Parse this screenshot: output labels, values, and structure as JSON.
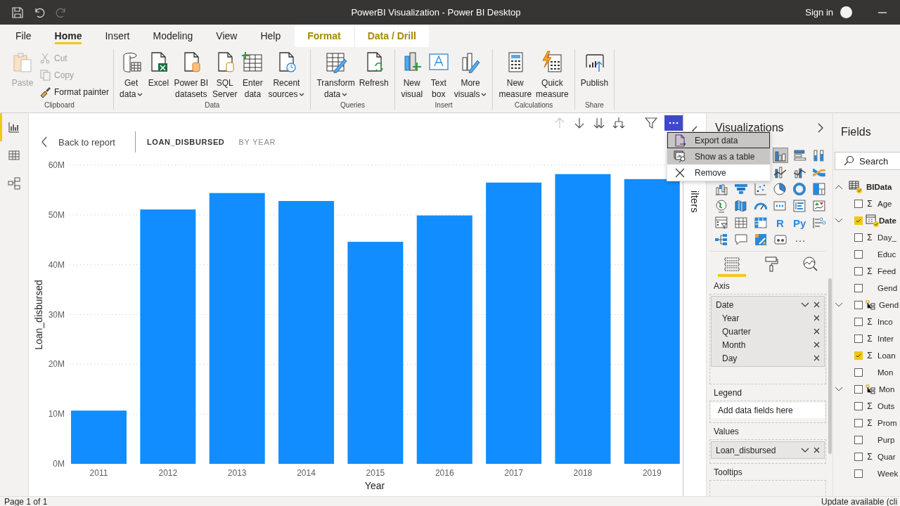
{
  "title_bar": {
    "title": "PowerBI Visualization - Power BI Desktop",
    "sign_in": "Sign in",
    "quick_access": [
      {
        "disabled": false
      },
      {
        "disabled": false
      },
      {
        "disabled": true
      }
    ]
  },
  "tabs": [
    {
      "label": "File",
      "selected": false,
      "contextual": false
    },
    {
      "label": "Home",
      "selected": true,
      "contextual": false
    },
    {
      "label": "Insert",
      "selected": false,
      "contextual": false
    },
    {
      "label": "Modeling",
      "selected": false,
      "contextual": false
    },
    {
      "label": "View",
      "selected": false,
      "contextual": false
    },
    {
      "label": "Help",
      "selected": false,
      "contextual": false
    },
    {
      "label": "Format",
      "selected": false,
      "contextual": true
    },
    {
      "label": "Data / Drill",
      "selected": false,
      "contextual": true
    }
  ],
  "ribbon": {
    "groups": [
      {
        "label": "Clipboard",
        "buttons": [
          {
            "lines": [
              "Paste"
            ],
            "kind": "large",
            "disabled": true,
            "dropdown": false
          },
          {
            "lines": [
              "Cut"
            ],
            "kind": "small",
            "disabled": true,
            "dropdown": false
          },
          {
            "lines": [
              "Copy"
            ],
            "kind": "small",
            "disabled": true,
            "dropdown": false
          },
          {
            "lines": [
              "Format painter"
            ],
            "kind": "small",
            "disabled": false,
            "dropdown": false
          }
        ]
      },
      {
        "label": "Data",
        "buttons": [
          {
            "lines": [
              "Get",
              "data"
            ],
            "kind": "large",
            "disabled": false,
            "dropdown": true
          },
          {
            "lines": [
              "Excel"
            ],
            "kind": "large",
            "disabled": false,
            "dropdown": false
          },
          {
            "lines": [
              "Power BI",
              "datasets"
            ],
            "kind": "large",
            "disabled": false,
            "dropdown": false
          },
          {
            "lines": [
              "SQL",
              "Server"
            ],
            "kind": "large",
            "disabled": false,
            "dropdown": false
          },
          {
            "lines": [
              "Enter",
              "data"
            ],
            "kind": "large",
            "disabled": false,
            "dropdown": false
          },
          {
            "lines": [
              "Recent",
              "sources"
            ],
            "kind": "large",
            "disabled": false,
            "dropdown": true
          }
        ]
      },
      {
        "label": "Queries",
        "buttons": [
          {
            "lines": [
              "Transform",
              "data"
            ],
            "kind": "large",
            "disabled": false,
            "dropdown": true
          },
          {
            "lines": [
              "Refresh"
            ],
            "kind": "large",
            "disabled": false,
            "dropdown": false
          }
        ]
      },
      {
        "label": "Insert",
        "buttons": [
          {
            "lines": [
              "New",
              "visual"
            ],
            "kind": "large",
            "disabled": false,
            "dropdown": false
          },
          {
            "lines": [
              "Text",
              "box"
            ],
            "kind": "large",
            "disabled": false,
            "dropdown": false
          },
          {
            "lines": [
              "More",
              "visuals"
            ],
            "kind": "large",
            "disabled": false,
            "dropdown": true
          }
        ]
      },
      {
        "label": "Calculations",
        "buttons": [
          {
            "lines": [
              "New",
              "measure"
            ],
            "kind": "large",
            "disabled": false,
            "dropdown": false
          },
          {
            "lines": [
              "Quick",
              "measure"
            ],
            "kind": "large",
            "disabled": false,
            "dropdown": false
          }
        ]
      },
      {
        "label": "Share",
        "buttons": [
          {
            "lines": [
              "Publish"
            ],
            "kind": "large",
            "disabled": false,
            "dropdown": false
          }
        ]
      }
    ]
  },
  "views": [
    {
      "selected": true
    },
    {
      "selected": false
    },
    {
      "selected": false
    }
  ],
  "visual_header": [
    {
      "disabled": true,
      "selected": false
    },
    {
      "disabled": false,
      "selected": false
    },
    {
      "disabled": false,
      "selected": false
    },
    {
      "disabled": false,
      "selected": false
    },
    {
      "disabled": false,
      "selected": false
    },
    {
      "disabled": false,
      "selected": true
    }
  ],
  "drillthrough": {
    "back": "Back to report",
    "measure": "LOAN_DISBURSED",
    "by": "BY YEAR"
  },
  "chart_data": {
    "type": "bar",
    "xlabel": "Year",
    "ylabel": "Loan_disbursed",
    "categories": [
      "2011",
      "2012",
      "2013",
      "2014",
      "2015",
      "2016",
      "2017",
      "2018",
      "2019"
    ],
    "series": [
      {
        "color": "#118dff",
        "values": [
          10700000,
          51100000,
          54400000,
          52800000,
          44600000,
          49900000,
          56500000,
          58200000,
          57200000
        ]
      }
    ],
    "ylim": [
      0,
      60000000
    ],
    "grid": true,
    "yticks": [
      {
        "value": 0,
        "label": "0M"
      },
      {
        "value": 10000000,
        "label": "10M"
      },
      {
        "value": 20000000,
        "label": "20M"
      },
      {
        "value": 30000000,
        "label": "30M"
      },
      {
        "value": 40000000,
        "label": "40M"
      },
      {
        "value": 50000000,
        "label": "50M"
      },
      {
        "value": 60000000,
        "label": "60M"
      }
    ]
  },
  "context_menu": [
    {
      "label": "Export data",
      "focused": true,
      "highlighted": true
    },
    {
      "label": "Show as a table",
      "focused": false,
      "highlighted": true
    },
    {
      "label": "Remove",
      "focused": false,
      "highlighted": false
    }
  ],
  "filters_pane": {
    "label": "ilters"
  },
  "visualizations": {
    "title": "Visualizations",
    "rows": [
      [
        {
          "kind": "icon",
          "selected": true
        },
        {
          "kind": "icon",
          "selected": false
        },
        {
          "kind": "icon",
          "selected": false
        }
      ],
      [
        {
          "kind": "icon",
          "selected": false
        },
        {
          "kind": "icon",
          "selected": false
        },
        {
          "kind": "icon",
          "selected": false
        }
      ],
      [
        {
          "kind": "icon",
          "selected": false
        },
        {
          "kind": "icon",
          "selected": false
        },
        {
          "kind": "icon",
          "selected": false
        },
        {
          "kind": "icon",
          "selected": false
        },
        {
          "kind": "icon",
          "selected": false
        },
        {
          "kind": "icon",
          "selected": false
        }
      ],
      [
        {
          "kind": "icon",
          "selected": false
        },
        {
          "kind": "icon",
          "selected": false
        },
        {
          "kind": "icon",
          "selected": false
        },
        {
          "kind": "icon",
          "selected": false
        },
        {
          "kind": "icon",
          "selected": false
        },
        {
          "kind": "icon",
          "selected": false
        }
      ],
      [
        {
          "kind": "icon",
          "selected": false
        },
        {
          "kind": "icon",
          "selected": false
        },
        {
          "kind": "icon",
          "selected": false
        },
        {
          "kind": "text",
          "text": "R",
          "selected": false
        },
        {
          "kind": "text",
          "text": "Py",
          "selected": false
        },
        {
          "kind": "icon",
          "selected": false
        }
      ],
      [
        {
          "kind": "icon",
          "selected": false
        },
        {
          "kind": "icon",
          "selected": false
        },
        {
          "kind": "icon",
          "selected": false
        },
        {
          "kind": "icon",
          "selected": false
        },
        {
          "kind": "text",
          "text": "···",
          "selected": false
        }
      ]
    ],
    "pane_tabs": [
      {
        "selected": true
      },
      {
        "selected": false
      },
      {
        "selected": false
      }
    ],
    "wells": [
      {
        "label": "Axis",
        "fields": [
          {
            "name": "Date",
            "children": [
              {
                "name": "Year"
              },
              {
                "name": "Quarter"
              },
              {
                "name": "Month"
              },
              {
                "name": "Day"
              }
            ]
          }
        ]
      },
      {
        "label": "Legend",
        "placeholder": "Add data fields here"
      },
      {
        "label": "Values",
        "fields": [
          {
            "name": "Loan_disbursed"
          }
        ]
      },
      {
        "label": "Tooltips"
      }
    ]
  },
  "fields": {
    "title": "Fields",
    "search": {
      "placeholder": "Search"
    },
    "tables": [
      {
        "name": "BIData",
        "expanded": true,
        "in_use": true,
        "items": [
          {
            "name": "Age",
            "kind": "sigma",
            "symbol": "Σ",
            "checked": false
          },
          {
            "name": "Date",
            "kind": "date",
            "checked": true,
            "in_use": true,
            "expanded": false
          },
          {
            "name": "Day_",
            "kind": "sigma",
            "symbol": "Σ",
            "checked": false
          },
          {
            "name": "Educ",
            "kind": "plain",
            "checked": false
          },
          {
            "name": "Feed",
            "kind": "sigma",
            "symbol": "Σ",
            "checked": false
          },
          {
            "name": "Gend",
            "kind": "plain",
            "checked": false
          },
          {
            "name": "Gend",
            "kind": "hierarchy",
            "checked": false,
            "expanded": false
          },
          {
            "name": "Inco",
            "kind": "sigma",
            "symbol": "Σ",
            "checked": false
          },
          {
            "name": "Inter",
            "kind": "sigma",
            "symbol": "Σ",
            "checked": false
          },
          {
            "name": "Loan",
            "kind": "sigma",
            "symbol": "Σ",
            "checked": true
          },
          {
            "name": "Mon",
            "kind": "plain",
            "checked": false
          },
          {
            "name": "Mon",
            "kind": "hierarchy",
            "checked": false,
            "expanded": false
          },
          {
            "name": "Outs",
            "kind": "sigma",
            "symbol": "Σ",
            "checked": false
          },
          {
            "name": "Prom",
            "kind": "sigma",
            "symbol": "Σ",
            "checked": false
          },
          {
            "name": "Purp",
            "kind": "plain",
            "checked": false
          },
          {
            "name": "Quar",
            "kind": "sigma",
            "symbol": "Σ",
            "checked": false
          },
          {
            "name": "Week",
            "kind": "plain",
            "checked": false
          }
        ]
      }
    ]
  },
  "status_bar": {
    "page": "Page 1 of 1",
    "update": "Update available (cli"
  }
}
